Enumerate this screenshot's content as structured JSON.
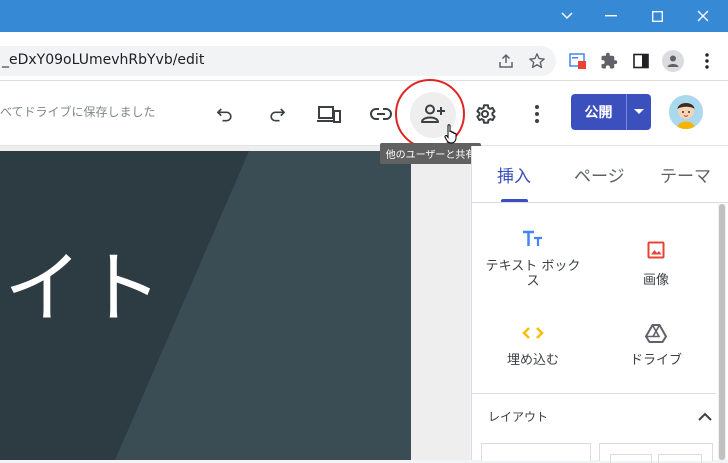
{
  "window": {
    "minimize_glyph": "—",
    "maximize_glyph": "☐",
    "close_glyph": "✕",
    "titlebar_color": "#3689d5"
  },
  "browser": {
    "url": "_eDxY09oLUmevhRbYvb/edit",
    "icons": [
      "chevron-down-icon",
      "share-page-icon",
      "star-icon",
      "extension-page-icon",
      "puzzle-icon",
      "side-panel-icon",
      "profile-icon",
      "more-vert-icon"
    ]
  },
  "toolbar": {
    "save_status": "べてドライブに保存しました",
    "publish_label": "公開",
    "accent": "#3b4fbd",
    "tooltip": "他のユーザーと共有",
    "icons": [
      "undo-icon",
      "redo-icon",
      "preview-devices-icon",
      "link-icon",
      "add-person-icon",
      "settings-gear-icon",
      "more-vert-icon"
    ]
  },
  "canvas": {
    "hero_title": "イト",
    "hero_color": "#37474f"
  },
  "panel": {
    "tabs": [
      {
        "label": "挿入",
        "selected": true
      },
      {
        "label": "ページ",
        "selected": false
      },
      {
        "label": "テーマ",
        "selected": false
      }
    ],
    "insert_items": [
      {
        "label": "テキスト ボックス",
        "icon": "text-box-icon",
        "color": "#4285f4"
      },
      {
        "label": "画像",
        "icon": "image-icon",
        "color": "#ea4335"
      },
      {
        "label": "埋め込む",
        "icon": "embed-code-icon",
        "color": "#fbbc04"
      },
      {
        "label": "ドライブ",
        "icon": "drive-icon",
        "color": "#5f6368"
      }
    ],
    "layout_section": "レイアウト"
  }
}
